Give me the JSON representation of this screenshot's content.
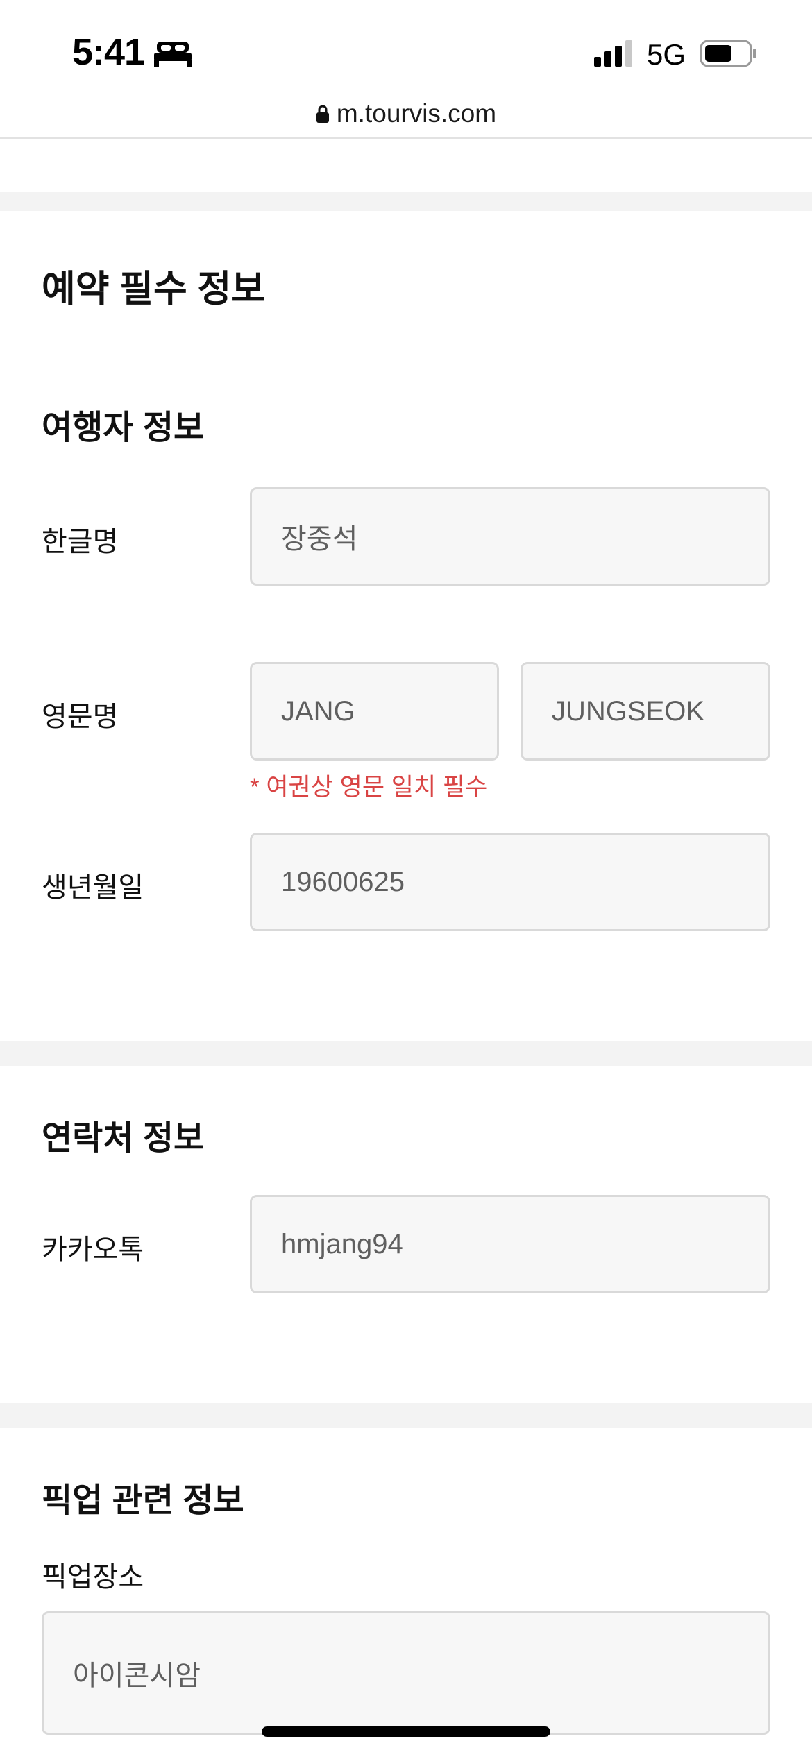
{
  "status_bar": {
    "time": "5:41",
    "network": "5G",
    "sleep_icon": "bed-icon",
    "signal_icon": "cellular-signal-icon",
    "battery_icon": "battery-icon"
  },
  "browser": {
    "url": "m.tourvis.com",
    "lock_icon": "lock-icon"
  },
  "colors": {
    "section_band": "#f3f3f3",
    "field_bg": "#f7f7f7",
    "field_border": "#d9d9d9",
    "warning_text": "#d94444"
  },
  "page": {
    "title": "예약 필수 정보"
  },
  "traveler": {
    "heading": "여행자 정보",
    "korean_name": {
      "label": "한글명",
      "value": "장중석"
    },
    "english_name": {
      "label": "영문명",
      "last_name": "JANG",
      "first_name": "JUNGSEOK",
      "note": "* 여권상 영문 일치 필수"
    },
    "birthdate": {
      "label": "생년월일",
      "value": "19600625"
    }
  },
  "contact": {
    "heading": "연락처 정보",
    "kakao": {
      "label": "카카오톡",
      "value": "hmjang94"
    }
  },
  "pickup": {
    "heading": "픽업 관련 정보",
    "location": {
      "label": "픽업장소",
      "value": "아이콘시암"
    }
  }
}
